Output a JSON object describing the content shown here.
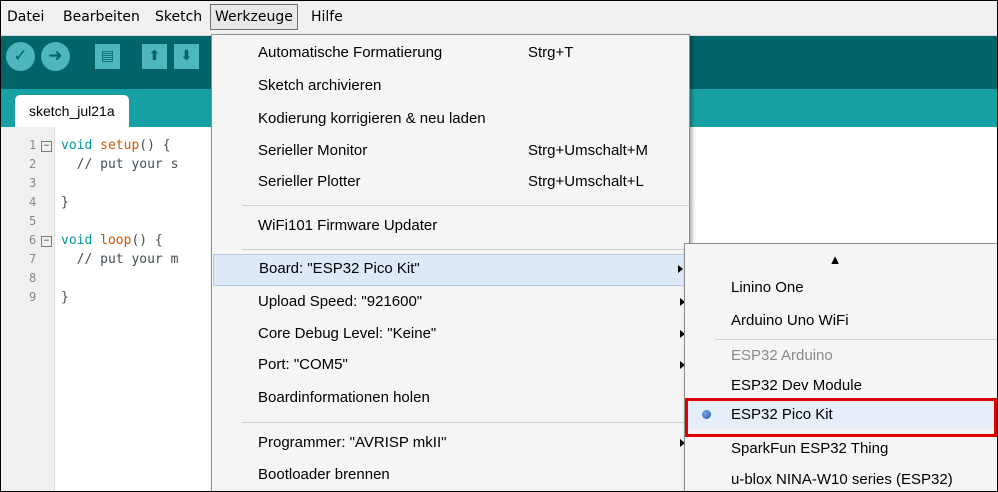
{
  "menubar": {
    "items": [
      "Datei",
      "Bearbeiten",
      "Sketch",
      "Werkzeuge",
      "Hilfe"
    ]
  },
  "toolbar": {
    "buttons": [
      "verify-icon",
      "upload-icon",
      "new-icon",
      "open-icon",
      "save-icon"
    ]
  },
  "tab": {
    "label": "sketch_jul21a"
  },
  "editor": {
    "line_numbers": [
      "1",
      "2",
      "3",
      "4",
      "5",
      "6",
      "7",
      "8",
      "9"
    ],
    "lines": [
      {
        "kw": "void",
        "fn": "setup",
        "rest": "() {"
      },
      {
        "text": "  // put your s"
      },
      {
        "text": ""
      },
      {
        "text": "}"
      },
      {
        "text": ""
      },
      {
        "kw": "void",
        "fn": "loop",
        "rest": "() {"
      },
      {
        "text": "  // put your m"
      },
      {
        "text": ""
      },
      {
        "text": "}"
      }
    ]
  },
  "tools_menu": {
    "items": [
      {
        "label": "Automatische Formatierung",
        "shortcut": "Strg+T"
      },
      {
        "label": "Sketch archivieren"
      },
      {
        "label": "Kodierung korrigieren & neu laden"
      },
      {
        "label": "Serieller Monitor",
        "shortcut": "Strg+Umschalt+M"
      },
      {
        "label": "Serieller Plotter",
        "shortcut": "Strg+Umschalt+L"
      },
      {
        "label": "WiFi101 Firmware Updater"
      },
      {
        "label": "Board: \"ESP32 Pico Kit\"",
        "submenu": true
      },
      {
        "label": "Upload Speed: \"921600\"",
        "submenu": true
      },
      {
        "label": "Core Debug Level: \"Keine\"",
        "submenu": true
      },
      {
        "label": "Port: \"COM5\"",
        "submenu": true
      },
      {
        "label": "Boardinformationen holen"
      },
      {
        "label": "Programmer: \"AVRISP mkII\"",
        "submenu": true
      },
      {
        "label": "Bootloader brennen"
      }
    ]
  },
  "board_menu": {
    "scroll_up": "▲",
    "items": [
      {
        "label": "Linino One"
      },
      {
        "label": "Arduino Uno WiFi"
      },
      {
        "label": "ESP32 Arduino",
        "disabled": true
      },
      {
        "label": "ESP32 Dev Module"
      },
      {
        "label": "ESP32 Pico Kit",
        "selected": true
      },
      {
        "label": "SparkFun ESP32 Thing"
      },
      {
        "label": "u-blox NINA-W10 series (ESP32)"
      }
    ]
  },
  "colors": {
    "toolbar": "#006468",
    "tabbar": "#17a1a5",
    "highlight": "#e00000"
  }
}
